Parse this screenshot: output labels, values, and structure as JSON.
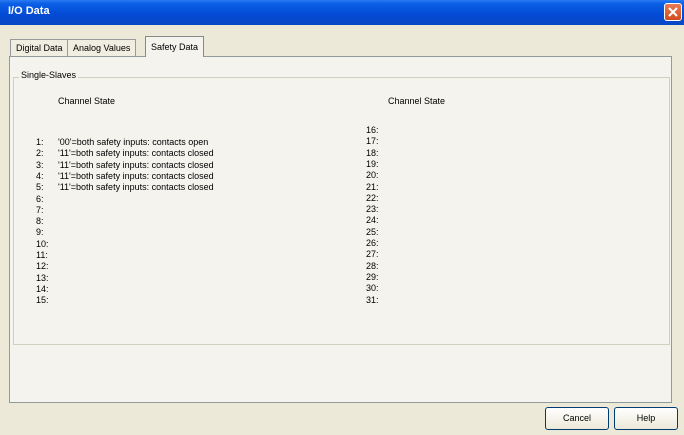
{
  "window": {
    "title": "I/O Data"
  },
  "tabs": [
    {
      "label": "Digital Data"
    },
    {
      "label": "Analog Values"
    },
    {
      "label": "Safety Data"
    }
  ],
  "group": {
    "label": "Single-Slaves",
    "left_header": "Channel State",
    "right_header": "Channel State"
  },
  "left_rows": [
    {
      "num": "1:",
      "state": "'00'=both safety inputs: contacts open"
    },
    {
      "num": "2:",
      "state": "'11'=both safety inputs: contacts closed"
    },
    {
      "num": "3:",
      "state": "'11'=both safety inputs: contacts closed"
    },
    {
      "num": "4:",
      "state": "'11'=both safety inputs: contacts closed"
    },
    {
      "num": "5:",
      "state": "'11'=both safety inputs: contacts closed"
    },
    {
      "num": "6:",
      "state": ""
    },
    {
      "num": "7:",
      "state": ""
    },
    {
      "num": "8:",
      "state": ""
    },
    {
      "num": "9:",
      "state": ""
    },
    {
      "num": "10:",
      "state": ""
    },
    {
      "num": "11:",
      "state": ""
    },
    {
      "num": "12:",
      "state": ""
    },
    {
      "num": "13:",
      "state": ""
    },
    {
      "num": "14:",
      "state": ""
    },
    {
      "num": "15:",
      "state": ""
    }
  ],
  "right_rows": [
    {
      "num": "16:",
      "state": ""
    },
    {
      "num": "17:",
      "state": ""
    },
    {
      "num": "18:",
      "state": ""
    },
    {
      "num": "19:",
      "state": ""
    },
    {
      "num": "20:",
      "state": ""
    },
    {
      "num": "21:",
      "state": ""
    },
    {
      "num": "22:",
      "state": ""
    },
    {
      "num": "23:",
      "state": ""
    },
    {
      "num": "24:",
      "state": ""
    },
    {
      "num": "25:",
      "state": ""
    },
    {
      "num": "26:",
      "state": ""
    },
    {
      "num": "27:",
      "state": ""
    },
    {
      "num": "28:",
      "state": ""
    },
    {
      "num": "29:",
      "state": ""
    },
    {
      "num": "30:",
      "state": ""
    },
    {
      "num": "31:",
      "state": ""
    }
  ],
  "buttons": {
    "cancel": "Cancel",
    "help": "Help"
  },
  "icons": {
    "close": "close-icon"
  }
}
